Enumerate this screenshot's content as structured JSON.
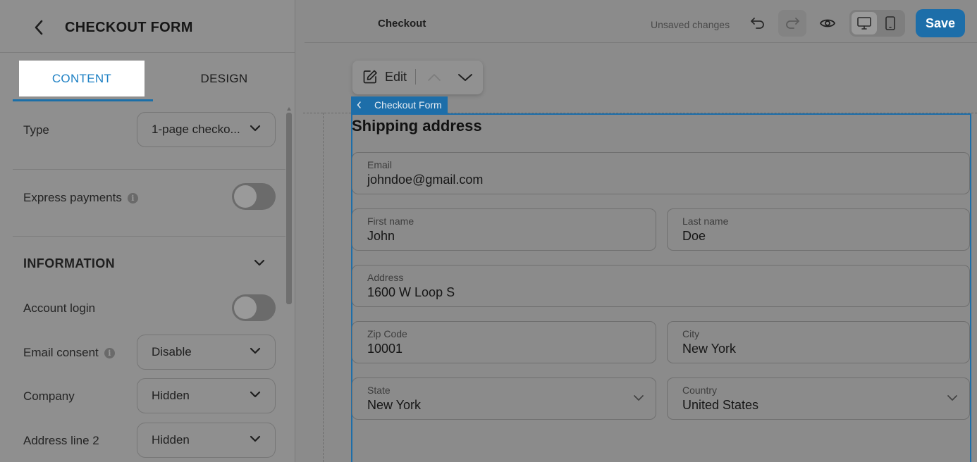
{
  "left_panel": {
    "title": "CHECKOUT FORM",
    "tabs": [
      {
        "label": "CONTENT",
        "active": true
      },
      {
        "label": "DESIGN",
        "active": false
      }
    ],
    "type": {
      "label": "Type",
      "value": "1-page checko..."
    },
    "express_payments": {
      "label": "Express payments",
      "enabled": false
    },
    "information": {
      "title": "INFORMATION"
    },
    "account_login": {
      "label": "Account login",
      "enabled": false
    },
    "email_consent": {
      "label": "Email consent",
      "value": "Disable"
    },
    "company": {
      "label": "Company",
      "value": "Hidden"
    },
    "address_line_2": {
      "label": "Address line 2",
      "value": "Hidden"
    }
  },
  "topbar": {
    "page_name": "Checkout",
    "status": "Unsaved changes",
    "save_label": "Save"
  },
  "toolbar": {
    "edit_label": "Edit"
  },
  "block": {
    "label": "Checkout Form"
  },
  "form": {
    "title": "Shipping address",
    "email": {
      "label": "Email",
      "value": "johndoe@gmail.com"
    },
    "first_name": {
      "label": "First name",
      "value": "John"
    },
    "last_name": {
      "label": "Last name",
      "value": "Doe"
    },
    "address": {
      "label": "Address",
      "value": "1600 W Loop S"
    },
    "zip": {
      "label": "Zip Code",
      "value": "10001"
    },
    "city": {
      "label": "City",
      "value": "New York"
    },
    "state": {
      "label": "State",
      "value": "New York"
    },
    "country": {
      "label": "Country",
      "value": "United States"
    }
  },
  "colors": {
    "accent": "#1d80c4",
    "save_bg": "#1d6ea9",
    "overlay_gray": "#8f8f8f"
  }
}
